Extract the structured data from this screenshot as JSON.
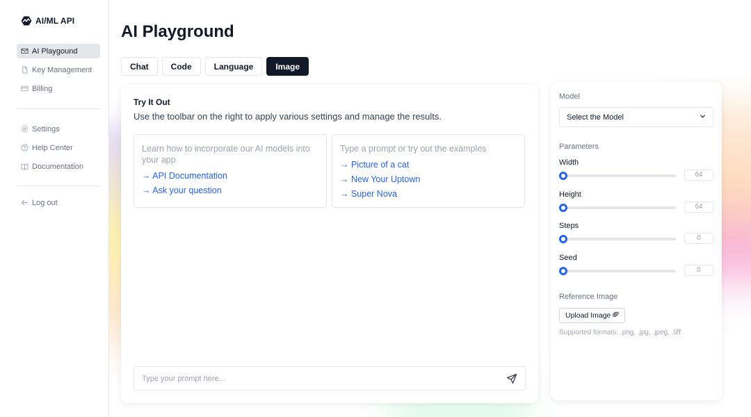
{
  "brand": {
    "name": "AI/ML API",
    "logo_icon": "pulse-logo-icon"
  },
  "sidebar": {
    "primary": [
      {
        "label": "AI Playgound",
        "icon": "mail-icon",
        "active": true
      },
      {
        "label": "Key Management",
        "icon": "document-icon",
        "active": false
      },
      {
        "label": "Billing",
        "icon": "credit-card-icon",
        "active": false
      }
    ],
    "secondary": [
      {
        "label": "Settings",
        "icon": "gear-icon"
      },
      {
        "label": "Help Center",
        "icon": "help-icon"
      },
      {
        "label": "Documentation",
        "icon": "book-icon"
      }
    ],
    "logout": {
      "label": "Log out",
      "icon": "arrow-left-icon"
    }
  },
  "page": {
    "title": "AI Playground"
  },
  "tabs": [
    {
      "label": "Chat",
      "active": false
    },
    {
      "label": "Code",
      "active": false
    },
    {
      "label": "Language",
      "active": false
    },
    {
      "label": "Image",
      "active": true
    }
  ],
  "try_it": {
    "title": "Try It Out",
    "subtitle": "Use the toolbar on the right to apply various settings and manage the results.",
    "left_box": {
      "hint": "Learn how to incorporate our AI models into your app",
      "links": [
        "→ API Documentation",
        "→ Ask your question"
      ]
    },
    "right_box": {
      "hint": "Type a prompt or try out the examples",
      "links": [
        "→ Picture of a cat",
        "→ New Your Uptown",
        "→ Super Nova"
      ]
    },
    "prompt_placeholder": "Type your prompt here...",
    "send_icon": "send-icon"
  },
  "settings": {
    "model_label": "Model",
    "model_select": "Select the Model",
    "parameters_label": "Parameters",
    "params": [
      {
        "name": "Width",
        "value": "64"
      },
      {
        "name": "Height",
        "value": "64"
      },
      {
        "name": "Steps",
        "value": "0"
      },
      {
        "name": "Seed",
        "value": "0"
      }
    ],
    "reference_label": "Reference Image",
    "upload_label": "Upload Image",
    "upload_icon": "paperclip-icon",
    "formats": "Supported formats: .png, .jpg, .jpeg, .tiff"
  },
  "colors": {
    "accent": "#2563eb",
    "dark": "#111827",
    "muted": "#6b7280"
  }
}
